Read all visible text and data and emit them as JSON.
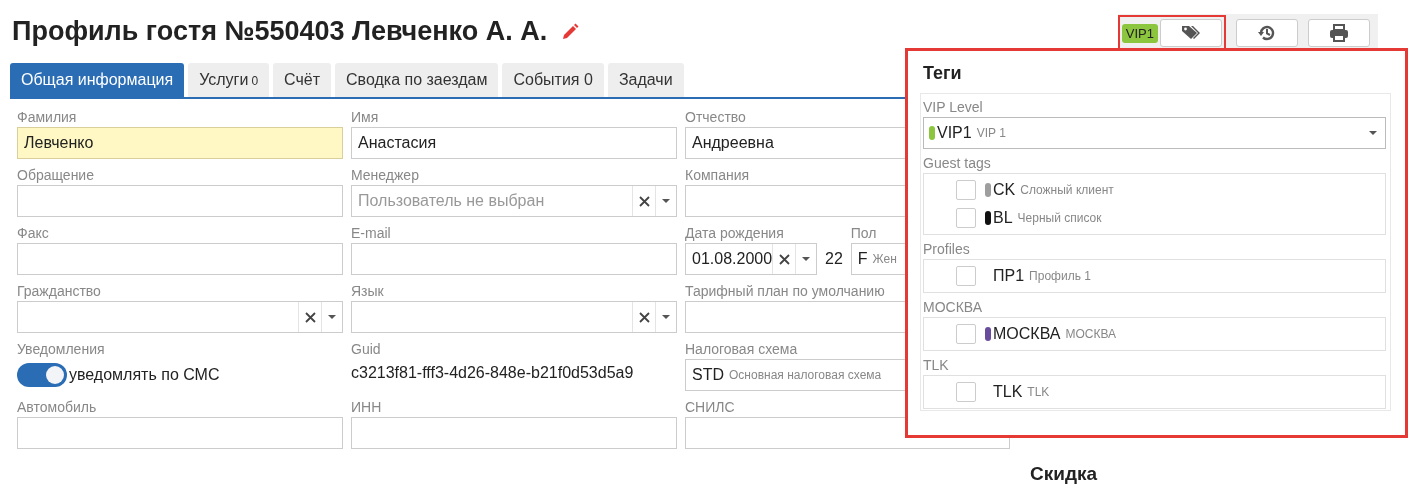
{
  "title": "Профиль гостя №550403 Левченко А. А.",
  "toolbar": {
    "vip_badge": {
      "text": "VIP1",
      "color": "#8cc63f"
    }
  },
  "tabs": [
    {
      "label": "Общая информация",
      "selected": true
    },
    {
      "label": "Услуги",
      "count": "0",
      "selected": false
    },
    {
      "label": "Счёт",
      "selected": false
    },
    {
      "label": "Сводка по заездам",
      "selected": false
    },
    {
      "label": "События 0",
      "selected": false
    },
    {
      "label": "Задачи",
      "selected": false
    }
  ],
  "form": [
    {
      "kind": "text",
      "label": "Фамилия",
      "value": "Левченко",
      "highlighted": true
    },
    {
      "kind": "text",
      "label": "Имя",
      "value": "Анастасия",
      "highlighted": false
    },
    {
      "kind": "text",
      "label": "Отчество",
      "value": "Андреевна",
      "highlighted": false
    },
    {
      "kind": "text",
      "label": "Обращение",
      "highlighted": false
    },
    {
      "kind": "select",
      "label": "Менеджер",
      "placeholder": "Пользователь не выбран"
    },
    {
      "kind": "text",
      "label": "Компания",
      "highlighted": false
    },
    {
      "kind": "text",
      "label": "Факс",
      "highlighted": false
    },
    {
      "kind": "text",
      "label": "E-mail",
      "highlighted": false
    },
    {
      "kind": "birth",
      "label": "Дата рождения",
      "value": "01.08.2000",
      "age": "22",
      "sex_label": "Пол",
      "sex_code": "F",
      "sex_name": "Жен"
    },
    {
      "kind": "select",
      "label": "Гражданство"
    },
    {
      "kind": "select",
      "label": "Язык"
    },
    {
      "kind": "text",
      "label": "Тарифный план по умолчанию",
      "highlighted": false
    },
    {
      "kind": "toggle",
      "label": "Уведомления",
      "text": "уведомлять по СМС",
      "on": true
    },
    {
      "kind": "static",
      "label": "Guid",
      "value": "c3213f81-fff3-4d26-848e-b21f0d53d5a9"
    },
    {
      "kind": "code",
      "label": "Налоговая схема",
      "code": "STD",
      "name": "Основная налоговая схема"
    },
    {
      "kind": "text",
      "label": "Автомобиль",
      "highlighted": false
    },
    {
      "kind": "text",
      "label": "ИНН",
      "highlighted": false
    },
    {
      "kind": "text",
      "label": "СНИЛС",
      "highlighted": false
    }
  ],
  "side": {
    "heading": "Скидка"
  },
  "tags_popup": {
    "title": "Теги",
    "groups": [
      {
        "label": "VIP Level",
        "kind": "select",
        "code": "VIP1",
        "name": "VIP 1",
        "color": "#8cc63f"
      },
      {
        "label": "Guest tags",
        "kind": "checklist",
        "items": [
          {
            "code": "CK",
            "name": "Сложный клиент",
            "color": "#9e9e9e",
            "checked": false
          },
          {
            "code": "BL",
            "name": "Черный список",
            "color": "#111111",
            "checked": false
          }
        ]
      },
      {
        "label": "Profiles",
        "kind": "checklist",
        "items": [
          {
            "code": "ПР1",
            "name": "Профиль 1",
            "checked": false
          }
        ]
      },
      {
        "label": "МОСКВА",
        "kind": "checklist",
        "items": [
          {
            "code": "МОСКВА",
            "name": "МОСКВА",
            "color": "#6a4c9c",
            "checked": false
          }
        ]
      },
      {
        "label": "TLK",
        "kind": "checklist",
        "items": [
          {
            "code": "TLK",
            "name": "TLK",
            "checked": false
          }
        ]
      }
    ]
  }
}
